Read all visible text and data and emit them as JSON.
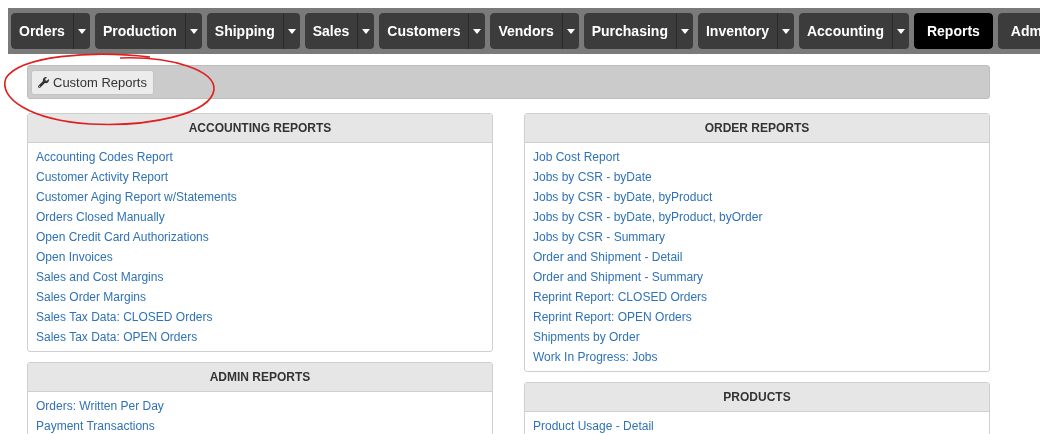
{
  "nav_tabs": [
    {
      "label": "Orders",
      "has_menu": true,
      "selected": false
    },
    {
      "label": "Production",
      "has_menu": true,
      "selected": false
    },
    {
      "label": "Shipping",
      "has_menu": true,
      "selected": false
    },
    {
      "label": "Sales",
      "has_menu": true,
      "selected": false
    },
    {
      "label": "Customers",
      "has_menu": true,
      "selected": false
    },
    {
      "label": "Vendors",
      "has_menu": true,
      "selected": false
    },
    {
      "label": "Purchasing",
      "has_menu": true,
      "selected": false
    },
    {
      "label": "Inventory",
      "has_menu": true,
      "selected": false
    },
    {
      "label": "Accounting",
      "has_menu": true,
      "selected": false
    },
    {
      "label": "Reports",
      "has_menu": false,
      "selected": true
    },
    {
      "label": "Adm",
      "has_menu": false,
      "selected": false
    }
  ],
  "toolbar": {
    "button": "Custom Reports"
  },
  "columns": [
    [
      {
        "title": "ACCOUNTING REPORTS",
        "links": [
          "Accounting Codes Report",
          "Customer Activity Report",
          "Customer Aging Report w/Statements",
          "Orders Closed Manually",
          "Open Credit Card Authorizations",
          "Open Invoices",
          "Sales and Cost Margins",
          "Sales Order Margins",
          "Sales Tax Data: CLOSED Orders",
          "Sales Tax Data: OPEN Orders"
        ]
      },
      {
        "title": "ADMIN REPORTS",
        "links": [
          "Orders: Written Per Day",
          "Payment Transactions"
        ]
      }
    ],
    [
      {
        "title": "ORDER REPORTS",
        "links": [
          "Job Cost Report",
          "Jobs by CSR - byDate",
          "Jobs by CSR - byDate, byProduct",
          "Jobs by CSR - byDate, byProduct, byOrder",
          "Jobs by CSR - Summary",
          "Order and Shipment - Detail",
          "Order and Shipment - Summary",
          "Reprint Report: CLOSED Orders",
          "Reprint Report: OPEN Orders",
          "Shipments by Order",
          "Work In Progress: Jobs"
        ]
      },
      {
        "title": "PRODUCTS",
        "links": [
          "Product Usage - Detail"
        ]
      }
    ]
  ]
}
